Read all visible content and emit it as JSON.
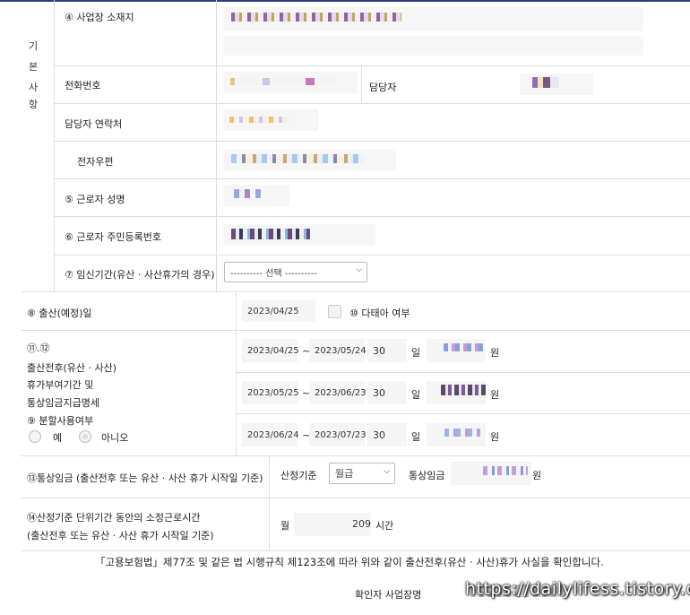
{
  "section": {
    "side_label": [
      "기",
      "본",
      "사",
      "항"
    ]
  },
  "fields": {
    "business_address": "④ 사업장 소재지",
    "phone": "전화번호",
    "manager": "담당자",
    "manager_contact": "담당자 연락처",
    "email": "전자우편",
    "worker_name": "⑤ 근로자 성명",
    "worker_rrn": "⑥ 근로자 주민등록번호",
    "pregnancy_period": "⑦ 임신기간(유산 · 사산휴가의 경우)",
    "pregnancy_select": "---------- 선택 ----------"
  },
  "birth": {
    "label": "⑧ 출산(예정)일",
    "date": "2023/04/25",
    "multiple_label": "⑩ 다태아 여부"
  },
  "leave": {
    "num_label": "⑪.⑫",
    "title_lines": [
      "출산전후(유산 · 사산)",
      "휴가부여기간 및",
      "통상임금지급명세"
    ],
    "split_label": "⑨ 분할사용여부",
    "yes": "예",
    "no": "아니오",
    "tilde": "~",
    "day_unit": "일",
    "won_unit": "원",
    "rows": [
      {
        "start": "2023/04/25",
        "end": "2023/05/24",
        "days": "30"
      },
      {
        "start": "2023/05/25",
        "end": "2023/06/23",
        "days": "30"
      },
      {
        "start": "2023/06/24",
        "end": "2023/07/23",
        "days": "30"
      }
    ]
  },
  "wage": {
    "label": "⑬통상임금 (출산전후 또는 유산 · 사산 휴가 시작일 기준)",
    "basis_label": "산정기준",
    "basis_value": "월급",
    "wage_label": "통상임금",
    "won_unit": "원"
  },
  "hours": {
    "label_line1": "⑭산정기준 단위기간 동안의 소정근로시간",
    "label_line2": "(출산전후 또는 유산 · 사산 휴가 시작일 기준)",
    "month": "월",
    "value": "209",
    "unit": "시간"
  },
  "footer": {
    "statement": "「고용보험법」제77조 및 같은 법 시행규칙 제123조에 따라 위와 같이 출산전후(유산 · 사산)휴가 사실을 확인합니다.",
    "confirm_label": "확인자 사업장명",
    "watermark": "https://dailylifess.tistory.com"
  }
}
